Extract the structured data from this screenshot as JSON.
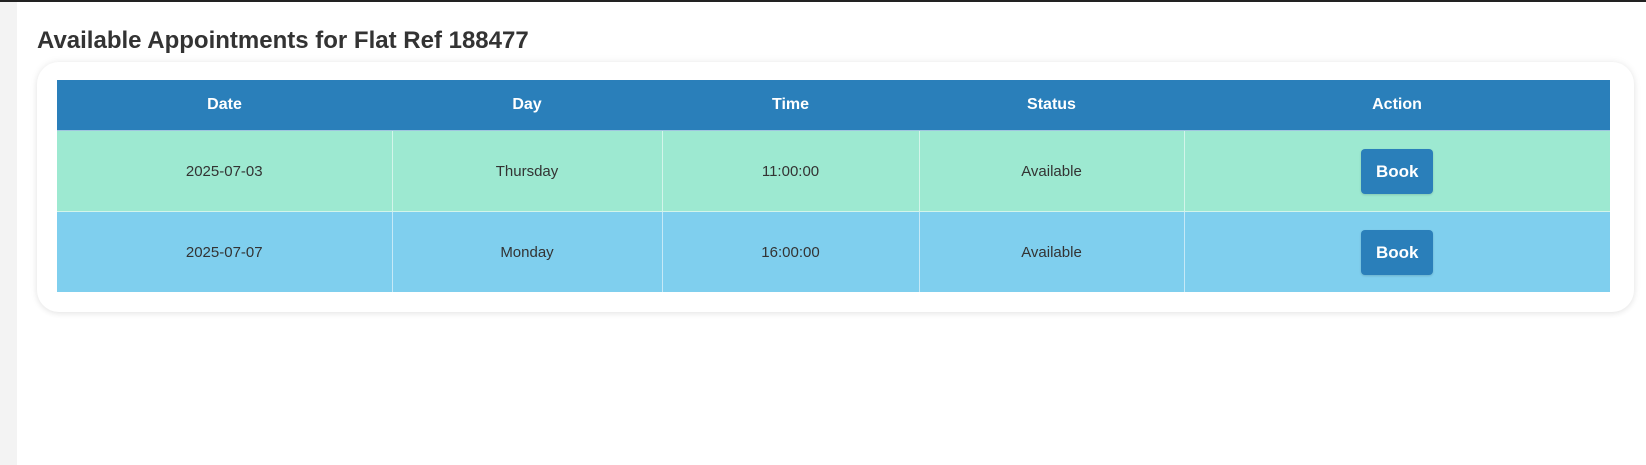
{
  "page": {
    "title": "Available Appointments for Flat Ref 188477"
  },
  "table": {
    "headers": [
      "Date",
      "Day",
      "Time",
      "Status",
      "Action"
    ],
    "rows": [
      {
        "date": "2025-07-03",
        "day": "Thursday",
        "time": "11:00:00",
        "status": "Available",
        "action": "Book"
      },
      {
        "date": "2025-07-07",
        "day": "Monday",
        "time": "16:00:00",
        "status": "Available",
        "action": "Book"
      }
    ]
  },
  "colors": {
    "header_bg": "#2a7fba",
    "row_0_bg": "#9de9d1",
    "row_1_bg": "#7fcfee",
    "button_bg": "#2a7fba"
  }
}
